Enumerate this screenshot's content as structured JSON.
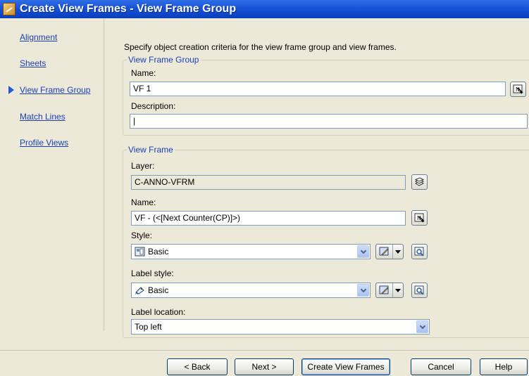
{
  "window": {
    "title": "Create View Frames - View Frame Group"
  },
  "nav": {
    "items": [
      {
        "label": "Alignment"
      },
      {
        "label": "Sheets"
      },
      {
        "label": "View Frame Group"
      },
      {
        "label": "Match Lines"
      },
      {
        "label": "Profile Views"
      }
    ],
    "current": "View Frame Group"
  },
  "main": {
    "intro": "Specify object creation criteria for the view frame group and view frames.",
    "view_frame_group": {
      "legend": "View Frame Group",
      "name_label": "Name:",
      "name_value": "VF 1",
      "description_label": "Description:",
      "description_value": "|"
    },
    "view_frame": {
      "legend": "View Frame",
      "layer_label": "Layer:",
      "layer_value": "C-ANNO-VFRM",
      "name_label": "Name:",
      "name_value": "VF - (<[Next Counter(CP)]>)",
      "style_label": "Style:",
      "style_value": "Basic",
      "label_style_label": "Label style:",
      "label_style_value": "Basic",
      "label_location_label": "Label location:",
      "label_location_value": "Top left"
    }
  },
  "buttons": {
    "back": "< Back",
    "next": "Next >",
    "create": "Create View Frames",
    "cancel": "Cancel",
    "help": "Help"
  },
  "icons": {
    "pick": "pick-from-drawing-icon",
    "layer": "layer-stack-icon",
    "edit": "edit-style-icon",
    "preview": "preview-style-icon",
    "style": "view-frame-style-icon",
    "label_style": "label-style-icon"
  },
  "colors": {
    "title_bar": "#1a55d8",
    "link": "#1a3fb4",
    "nav_arrow": "#1f5fd0",
    "dialog_bg": "#ece9d8"
  }
}
